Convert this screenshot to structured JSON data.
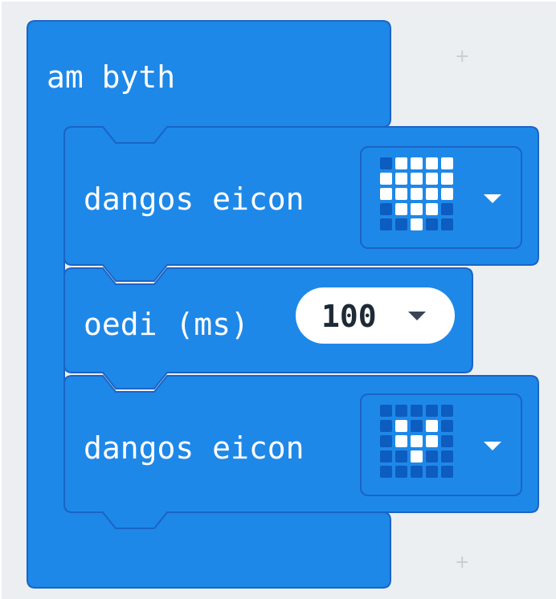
{
  "workspace": {
    "background": "#eceff1",
    "block_color": "#1e88e8",
    "block_border_color": "#1a64c7"
  },
  "forever_block": {
    "label": "am byth"
  },
  "show_icon_1": {
    "label": "dangos eicon",
    "icon": "heart-large",
    "leds": [
      [
        0,
        1,
        1,
        1,
        1
      ],
      [
        1,
        1,
        1,
        1,
        1
      ],
      [
        1,
        1,
        1,
        1,
        1
      ],
      [
        0,
        1,
        1,
        1,
        0
      ],
      [
        0,
        0,
        1,
        0,
        0
      ]
    ]
  },
  "pause_block": {
    "label": "oedi (ms)",
    "value": "100"
  },
  "show_icon_2": {
    "label": "dangos eicon",
    "icon": "heart-small",
    "leds": [
      [
        0,
        0,
        0,
        0,
        0
      ],
      [
        0,
        1,
        0,
        1,
        0
      ],
      [
        0,
        1,
        1,
        1,
        0
      ],
      [
        0,
        0,
        1,
        0,
        0
      ],
      [
        0,
        0,
        0,
        0,
        0
      ]
    ]
  },
  "grid_markers": [
    "+",
    "+"
  ]
}
